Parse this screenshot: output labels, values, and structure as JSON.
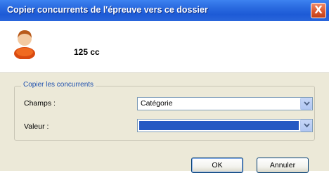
{
  "window": {
    "title": "Copier concurrents de l'épreuve vers ce dossier",
    "close_label": "X"
  },
  "header": {
    "label": "125 cc",
    "icon": "user-icon"
  },
  "group": {
    "legend": "Copier les concurrents",
    "fields": [
      {
        "label": "Champs :",
        "value": "Catégorie"
      },
      {
        "label": "Valeur :",
        "value": ""
      }
    ]
  },
  "buttons": {
    "ok": "OK",
    "cancel": "Annuler"
  },
  "colors": {
    "title_bar": "#2a6be0",
    "close": "#d9542a",
    "selection": "#2559c3"
  }
}
